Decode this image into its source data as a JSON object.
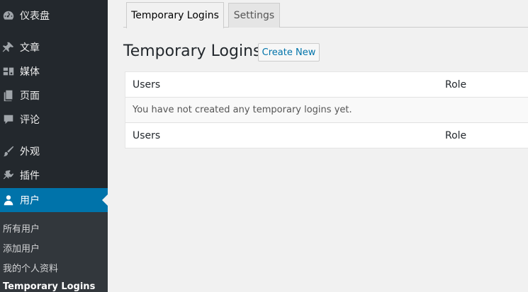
{
  "sidebar": {
    "items": [
      {
        "label": "仪表盘",
        "icon": "dashboard-icon"
      },
      {
        "label": "文章",
        "icon": "pin-icon"
      },
      {
        "label": "媒体",
        "icon": "media-icon"
      },
      {
        "label": "页面",
        "icon": "page-icon"
      },
      {
        "label": "评论",
        "icon": "comment-icon"
      },
      {
        "label": "外观",
        "icon": "brush-icon"
      },
      {
        "label": "插件",
        "icon": "plugin-icon"
      },
      {
        "label": "用户",
        "icon": "user-icon",
        "active": true
      }
    ],
    "submenu": [
      {
        "label": "所有用户"
      },
      {
        "label": "添加用户"
      },
      {
        "label": "我的个人资料"
      },
      {
        "label": "Temporary Logins",
        "current": true
      }
    ]
  },
  "tabs": [
    {
      "label": "Temporary Logins",
      "active": true
    },
    {
      "label": "Settings",
      "active": false
    }
  ],
  "page": {
    "title": "Temporary Logins",
    "create_button": "Create New"
  },
  "table": {
    "columns": [
      "Users",
      "Role"
    ],
    "empty_message": "You have not created any temporary logins yet.",
    "footer_columns": [
      "Users",
      "Role"
    ]
  },
  "colors": {
    "sidebar_bg": "#23282d",
    "submenu_bg": "#32373c",
    "accent": "#0073aa",
    "page_bg": "#f1f1f1"
  }
}
